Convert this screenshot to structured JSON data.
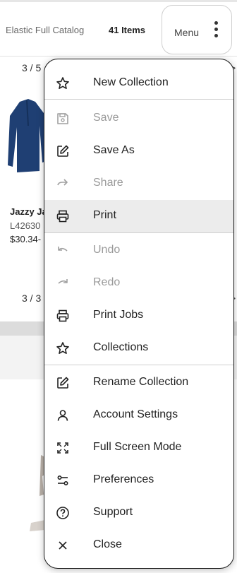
{
  "header": {
    "catalog_name": "Elastic Full Catalog",
    "item_count": "41 Items",
    "menu_label": "Menu"
  },
  "background": {
    "page_indicator_1": "3 / 5",
    "page_indicator_2": "3 / 3",
    "product": {
      "name": "Jazzy Ja",
      "sku": "L42630",
      "price": "$30.34-"
    }
  },
  "menu": {
    "items": [
      {
        "label": "New Collection",
        "icon": "star-outline-icon",
        "enabled": true
      },
      {
        "label": "Save",
        "icon": "save-icon",
        "enabled": false
      },
      {
        "label": "Save As",
        "icon": "edit-icon",
        "enabled": true
      },
      {
        "label": "Share",
        "icon": "share-arrow-icon",
        "enabled": false
      },
      {
        "label": "Print",
        "icon": "printer-icon",
        "enabled": true,
        "highlighted": true
      },
      {
        "label": "Undo",
        "icon": "undo-icon",
        "enabled": false
      },
      {
        "label": "Redo",
        "icon": "redo-icon",
        "enabled": false
      },
      {
        "label": "Print Jobs",
        "icon": "printer-icon",
        "enabled": true
      },
      {
        "label": "Collections",
        "icon": "star-outline-icon",
        "enabled": true
      },
      {
        "label": "Rename Collection",
        "icon": "edit-icon",
        "enabled": true
      },
      {
        "label": "Account Settings",
        "icon": "user-icon",
        "enabled": true
      },
      {
        "label": "Full Screen Mode",
        "icon": "fullscreen-icon",
        "enabled": true
      },
      {
        "label": "Preferences",
        "icon": "sliders-icon",
        "enabled": true
      },
      {
        "label": "Support",
        "icon": "help-circle-icon",
        "enabled": true
      },
      {
        "label": "Close",
        "icon": "close-icon",
        "enabled": true
      }
    ]
  },
  "colors": {
    "enabled_text": "#222222",
    "disabled_text": "#9a9a9a",
    "highlight_bg": "#ececec",
    "jacket": "#1f3f73"
  }
}
